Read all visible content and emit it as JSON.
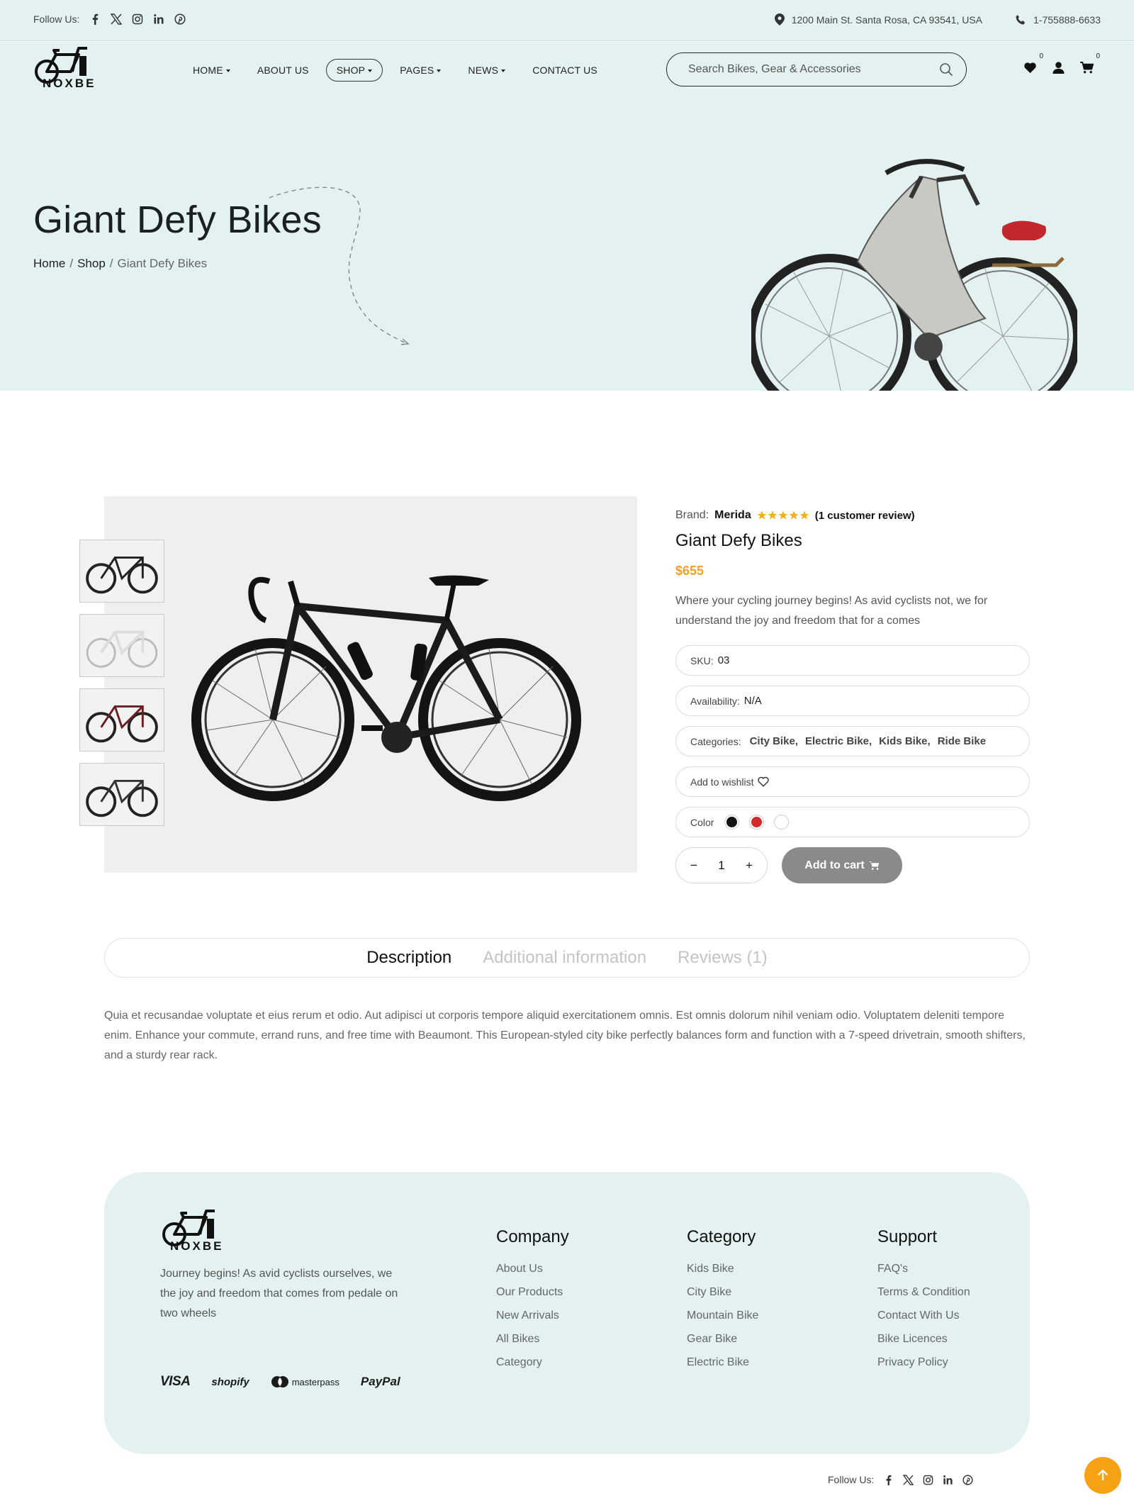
{
  "topbar": {
    "follow_label": "Follow Us:",
    "social_icons": [
      "facebook-icon",
      "x-icon",
      "instagram-icon",
      "linkedin-icon",
      "pinterest-icon"
    ],
    "address": "1200 Main St. Santa Rosa, CA 93541, USA",
    "phone": "1-755888-6633"
  },
  "brand": {
    "logo_text": "NOXBE"
  },
  "nav": {
    "items": [
      {
        "label": "HOME",
        "dropdown": true
      },
      {
        "label": "ABOUT US",
        "dropdown": false
      },
      {
        "label": "SHOP",
        "dropdown": true,
        "active": true
      },
      {
        "label": "PAGES",
        "dropdown": true
      },
      {
        "label": "NEWS",
        "dropdown": true
      },
      {
        "label": "CONTACT US",
        "dropdown": false
      }
    ],
    "search_placeholder": "Search Bikes, Gear & Accessories",
    "wishlist_count": "0",
    "cart_count": "0"
  },
  "hero": {
    "title": "Giant Defy Bikes",
    "breadcrumb": [
      "Home",
      "Shop",
      "Giant Defy Bikes"
    ],
    "separator": "/"
  },
  "product": {
    "brand_label": "Brand:",
    "brand": "Merida",
    "rating": 5,
    "review_text": "(1 customer review)",
    "title": "Giant Defy Bikes",
    "price": "$655",
    "short_description": "Where your cycling journey begins! As avid cyclists not, we for understand the joy and freedom that for a comes",
    "sku_label": "SKU:",
    "sku": "03",
    "availability_label": "Availability:",
    "availability": "N/A",
    "categories_label": "Categories:",
    "categories": [
      "City Bike,",
      "Electric Bike,",
      "Kids Bike,",
      "Ride Bike"
    ],
    "wishlist_label": "Add to wishlist",
    "color_label": "Color",
    "colors": [
      "#111111",
      "#d42a2a",
      "#ffffff"
    ],
    "quantity": "1",
    "minus": "−",
    "plus": "+",
    "add_to_cart": "Add to cart",
    "accent_color": "#f0a02b"
  },
  "tabs": {
    "items": [
      "Description",
      "Additional information",
      "Reviews (1)"
    ],
    "active": 0
  },
  "description": "Quia et recusandae voluptate et eius rerum et odio. Aut adipisci ut corporis tempore aliquid exercitationem omnis. Est omnis dolorum nihil veniam odio. Voluptatem deleniti tempore enim. Enhance your commute, errand runs, and free time with Beaumont. This European-styled city bike perfectly balances form and function with a 7-speed drivetrain, smooth shifters, and a sturdy rear rack.",
  "footer": {
    "about": "Journey begins! As avid cyclists ourselves, we the joy and freedom that comes from pedale on two wheels",
    "payments": [
      "VISA",
      "shopify",
      "masterpass",
      "PayPal"
    ],
    "columns": [
      {
        "title": "Company",
        "links": [
          "About Us",
          "Our Products",
          "New Arrivals",
          "All Bikes",
          "Category"
        ]
      },
      {
        "title": "Category",
        "links": [
          "Kids Bike",
          "City Bike",
          "Mountain Bike",
          "Gear Bike",
          "Electric Bike"
        ]
      },
      {
        "title": "Support",
        "links": [
          "FAQ's",
          "Terms & Condition",
          "Contact With Us",
          "Bike Licences",
          "Privacy Policy"
        ]
      }
    ],
    "follow_label": "Follow Us:"
  },
  "theme": {
    "mint": "#e3f2f1",
    "orange": "#f7a214"
  }
}
